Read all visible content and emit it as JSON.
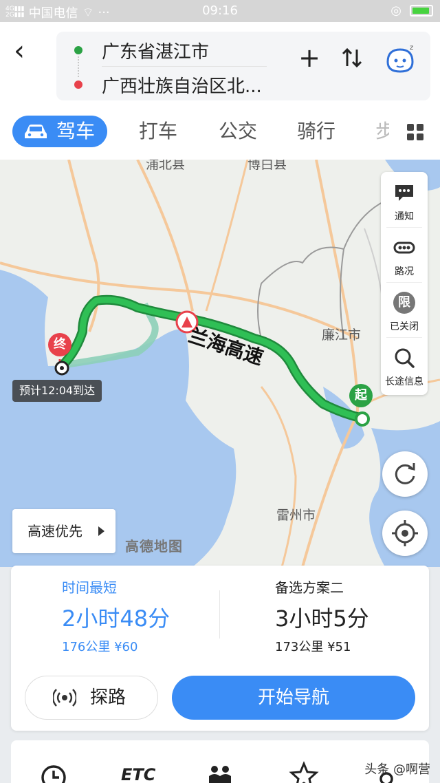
{
  "status_bar": {
    "carrier": "中国电信",
    "time": "09:16",
    "signal": "4G 2G"
  },
  "header": {
    "start": "广东省湛江市",
    "end": "广西壮族自治区北...",
    "tabs": [
      "驾车",
      "打车",
      "公交",
      "骑行",
      "步"
    ]
  },
  "map": {
    "labels": {
      "county_left": "浦北县",
      "county_right": "博白县",
      "city_a": "廉江市",
      "city_b": "雷州市",
      "highway": "兰海高速"
    },
    "eta": "预计12:04到达",
    "start_pin": "起",
    "end_pin": "终",
    "side_panel": {
      "notice": "通知",
      "traffic": "路况",
      "limit": "已关闭",
      "limit_badge": "限",
      "long_route": "长途信息"
    },
    "preference": "高速优先",
    "watermark": "高德地图"
  },
  "plans": [
    {
      "tag": "时间最短",
      "duration": "2小时48分",
      "meta": "176公里 ¥60"
    },
    {
      "tag": "备选方案二",
      "duration": "3小时5分",
      "meta": "173公里 ¥51"
    }
  ],
  "actions": {
    "explore": "探路",
    "navigate": "开始导航"
  },
  "toolbar": {
    "etc": "ETC"
  },
  "credit": "头条 @啊营",
  "colors": {
    "accent": "#3a8cf5",
    "route": "#22a848",
    "start": "#2ba245",
    "end": "#e8414b"
  }
}
